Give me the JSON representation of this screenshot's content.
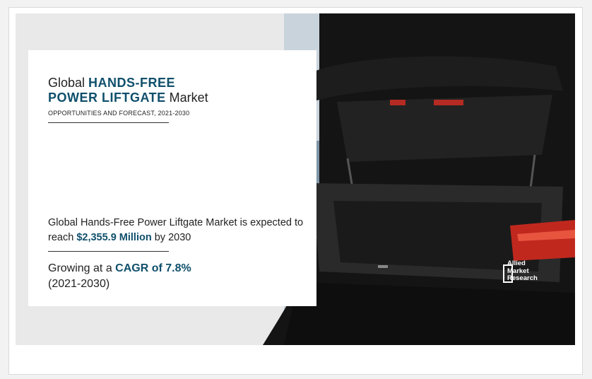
{
  "banner": {
    "title_prefix": "Global",
    "title_highlight_1": "HANDS-FREE",
    "title_highlight_2": "POWER LIFTGATE",
    "title_suffix": "Market",
    "subtitle": "OPPORTUNITIES AND FORECAST, 2021-2030",
    "stat1_text": "Global Hands-Free Power Liftgate Market is expected to reach",
    "stat1_value": "$2,355.9 Million",
    "stat1_suffix": "by 2030",
    "stat2_prefix": "Growing at a",
    "stat2_value": "CAGR of 7.8%",
    "stat2_period": "(2021-2030)"
  },
  "logo": {
    "line1": "Allied",
    "line2": "Market",
    "line3": "Research"
  },
  "colors": {
    "accent": "#0f4f6b",
    "background": "#e9e9e9",
    "car_body": "#141414",
    "tail_light": "#c0281e"
  }
}
